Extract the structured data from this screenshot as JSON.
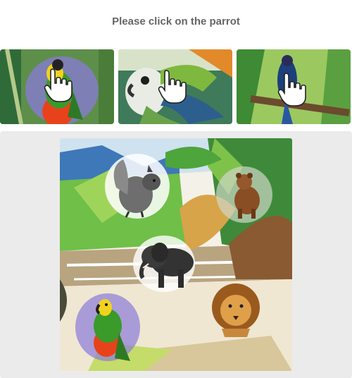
{
  "captcha": {
    "prompt": "Please click on the parrot",
    "examples": [
      {
        "subject": "parrot",
        "icon": "pointer-hand-icon"
      },
      {
        "subject": "parrot",
        "icon": "pointer-hand-icon"
      },
      {
        "subject": "parrot",
        "icon": "pointer-hand-icon"
      }
    ],
    "scene": {
      "animals": [
        "squirrel",
        "bear",
        "elephant",
        "lion",
        "parrot"
      ]
    },
    "colors": {
      "prompt_text": "#666666",
      "panel_background": "#ebebeb"
    }
  }
}
